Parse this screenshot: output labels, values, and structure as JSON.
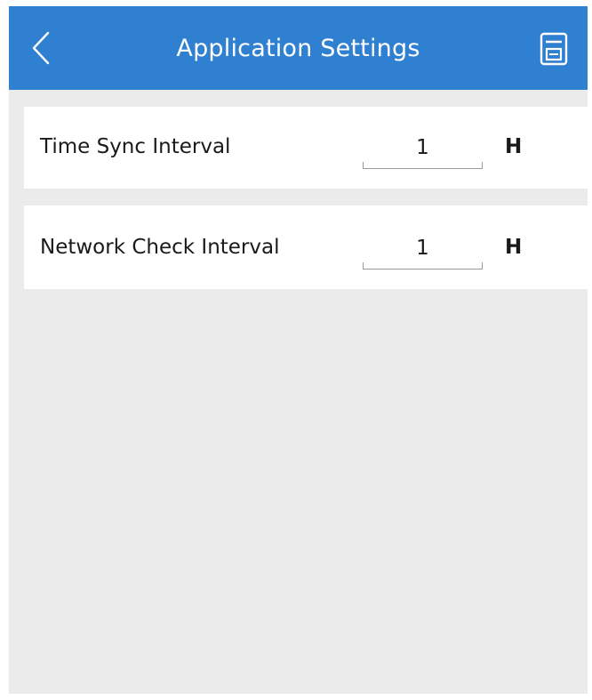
{
  "header": {
    "title": "Application Settings",
    "back_icon": "chevron-left-icon",
    "save_icon": "save-icon",
    "background_color": "#2f80d1"
  },
  "settings": [
    {
      "label": "Time Sync Interval",
      "value": "1",
      "unit": "H"
    },
    {
      "label": "Network Check Interval",
      "value": "1",
      "unit": "H"
    }
  ]
}
